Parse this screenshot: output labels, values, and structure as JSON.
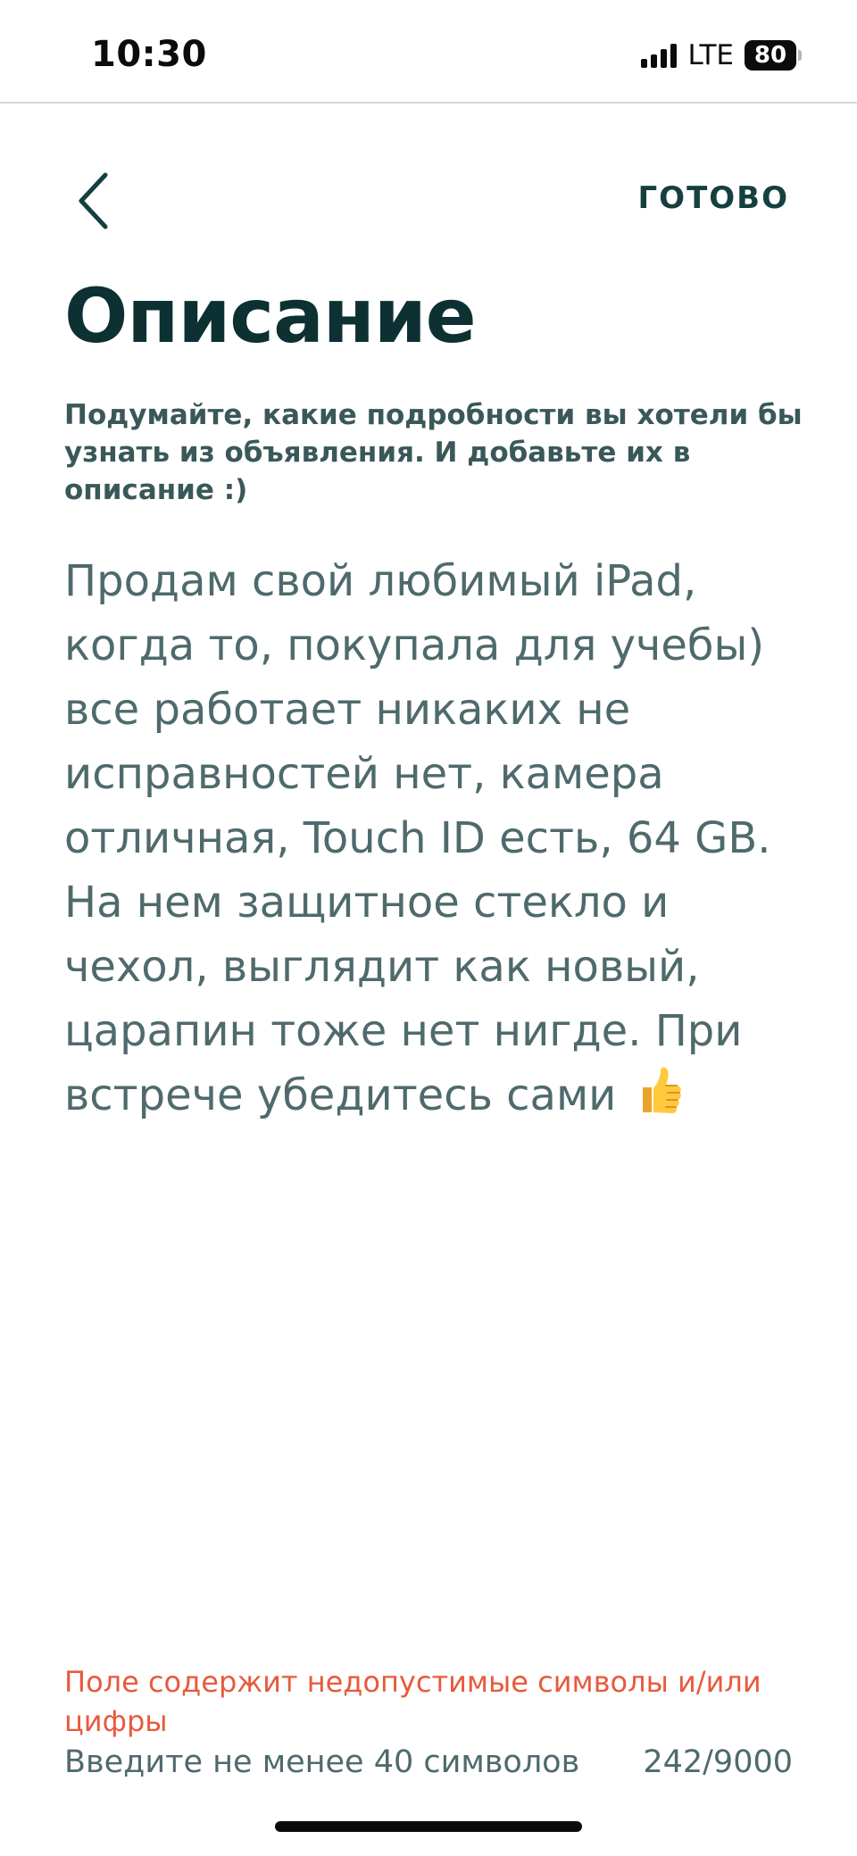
{
  "status_bar": {
    "time": "10:30",
    "network": "LTE",
    "battery": "80",
    "icons": [
      "signal-icon",
      "battery-icon"
    ]
  },
  "header": {
    "back_icon": "chevron-left-icon",
    "done_label": "ГОТОВО"
  },
  "main": {
    "title": "Описание",
    "hint": "Подумайте, какие подробности вы хотели бы узнать из объявления. И добавьте их в описание :)",
    "description_value": "Продам свой любимый iPad, когда то, покупала для учебы) все работает никаких не исправностей нет, камера отличная, Touch ID есть, 64 GB. На нем защитное стекло и чехол, выглядит как новый, царапин тоже нет нигде. При встрече убедитесь сами",
    "description_emoji": "thumbs-up-icon"
  },
  "footer": {
    "error": "Поле содержит недопустимые символы и/или цифры",
    "min_hint": "Введите не менее 40 символов",
    "counter": "242/9000"
  },
  "colors": {
    "title": "#0d3133",
    "accent_done": "#163f40",
    "body_text": "#4f6a6c",
    "error": "#e85a3c"
  }
}
